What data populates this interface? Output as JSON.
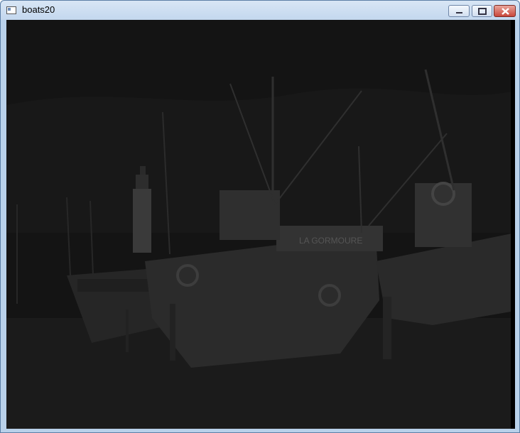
{
  "window": {
    "title": "boats20",
    "icon": "app-window-icon",
    "controls": {
      "minimize": "minimize-icon",
      "maximize": "maximize-icon",
      "close": "close-icon"
    }
  },
  "image": {
    "boat_name_text": "LA GORMOURE"
  },
  "colors": {
    "titlebar_top": "#d8e6f5",
    "titlebar_bottom": "#c3d7ee",
    "frame": "#b9d1ea",
    "close_button": "#c9463a",
    "image_dark": "#141414"
  }
}
